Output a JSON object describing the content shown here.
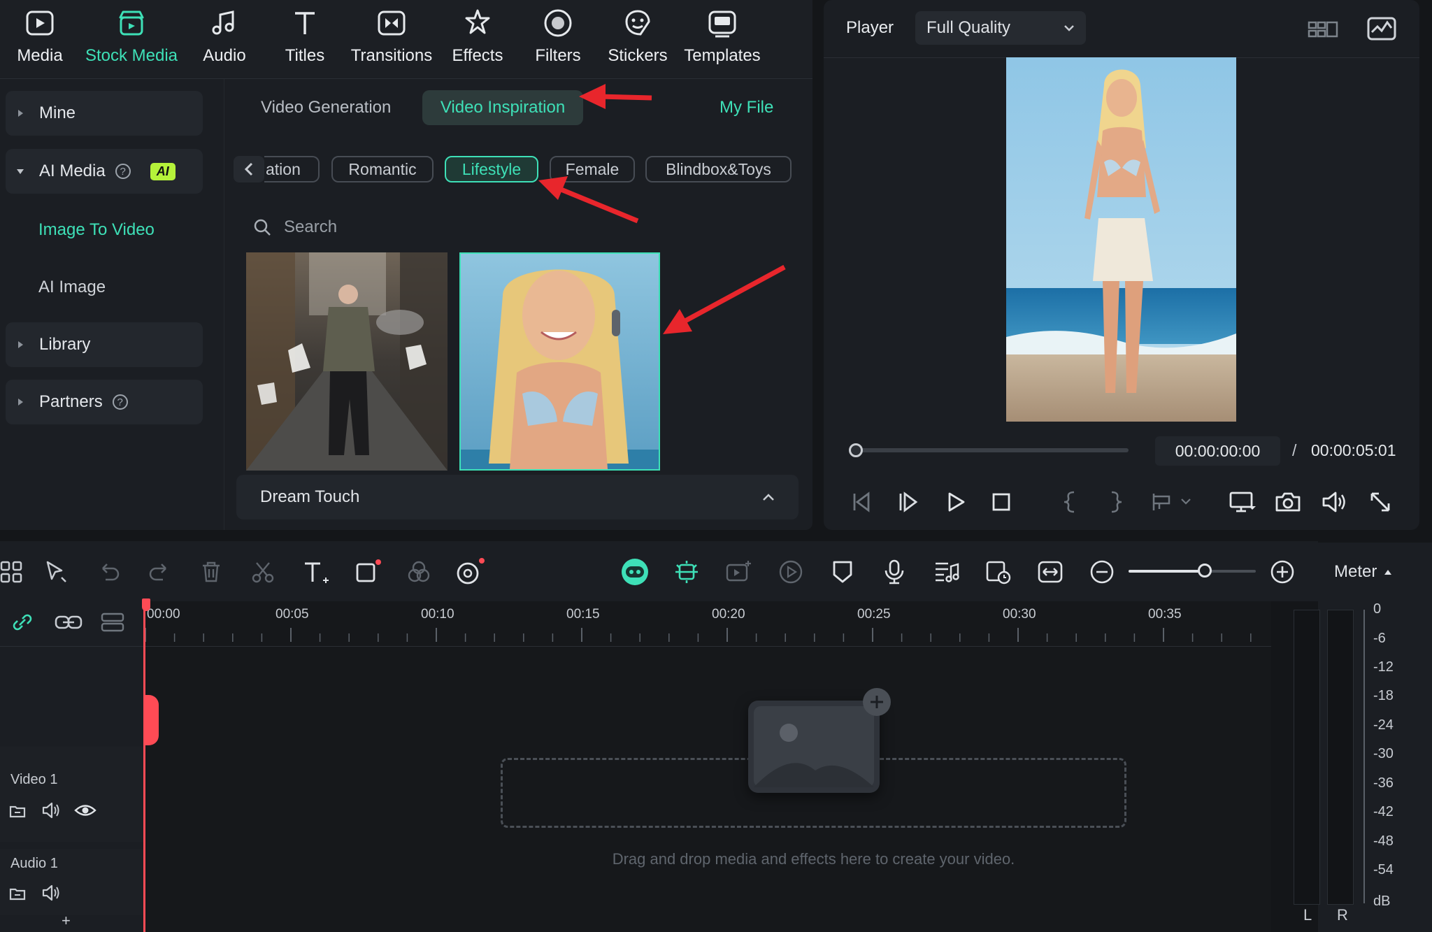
{
  "toolbar": {
    "tabs": [
      {
        "label": "Media",
        "icon": "media-icon"
      },
      {
        "label": "Stock Media",
        "icon": "stock-media-icon",
        "active": true
      },
      {
        "label": "Audio",
        "icon": "audio-icon"
      },
      {
        "label": "Titles",
        "icon": "titles-icon"
      },
      {
        "label": "Transitions",
        "icon": "transitions-icon"
      },
      {
        "label": "Effects",
        "icon": "effects-icon"
      },
      {
        "label": "Filters",
        "icon": "filters-icon"
      },
      {
        "label": "Stickers",
        "icon": "stickers-icon"
      },
      {
        "label": "Templates",
        "icon": "templates-icon"
      }
    ]
  },
  "sidebar": {
    "mine": "Mine",
    "ai_media": "AI Media",
    "ai_badge": "AI",
    "image_to_video": "Image To Video",
    "ai_image": "AI Image",
    "library": "Library",
    "partners": "Partners"
  },
  "content": {
    "tabs": {
      "video_generation": "Video Generation",
      "video_inspiration": "Video Inspiration",
      "my_file": "My File"
    },
    "chips": [
      "ation",
      "Romantic",
      "Lifestyle",
      "Female",
      "Blindbox&Toys"
    ],
    "active_chip": "Lifestyle",
    "search_placeholder": "Search",
    "section_title": "Dream Touch"
  },
  "player": {
    "label": "Player",
    "quality": "Full Quality",
    "current_time": "00:00:00:00",
    "separator": "/",
    "total_time": "00:00:05:01",
    "progress": 0.0
  },
  "timeline": {
    "ruler_labels": [
      "00:00",
      "00:05",
      "00:10",
      "00:15",
      "00:20",
      "00:25",
      "00:30",
      "00:35"
    ],
    "tracks": [
      {
        "name": "Video 1"
      },
      {
        "name": "Audio 1"
      }
    ],
    "add_track": "+",
    "drop_hint": "Drag and drop media and effects here to create your video.",
    "zoom_level": 0.6
  },
  "meter": {
    "title": "Meter",
    "scale": [
      "0",
      "-6",
      "-12",
      "-18",
      "-24",
      "-30",
      "-36",
      "-42",
      "-48",
      "-54",
      "dB"
    ],
    "left": "L",
    "right": "R"
  },
  "colors": {
    "accent": "#3ee0b7",
    "annotation": "#e8262c",
    "playhead": "#ff4b55",
    "ai_badge": "#b5f23a"
  }
}
